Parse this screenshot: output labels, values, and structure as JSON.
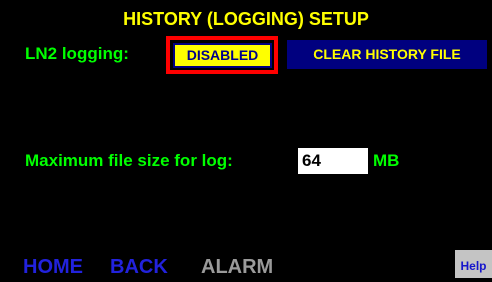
{
  "title": "HISTORY (LOGGING) SETUP",
  "logging": {
    "label": "LN2 logging:",
    "toggle_label": "DISABLED",
    "clear_button_label": "CLEAR HISTORY FILE"
  },
  "max_file_size": {
    "label": "Maximum file size for log:",
    "value": "64",
    "unit": "MB"
  },
  "nav": {
    "home": "HOME",
    "back": "BACK",
    "alarm": "ALARM",
    "help": "Help"
  },
  "colors": {
    "background": "#000000",
    "title": "#ffff00",
    "label": "#00ff00",
    "toggle_bg": "#ffff00",
    "toggle_highlight": "#ff0000",
    "clear_button_bg": "#00007f",
    "nav_active": "#2222dd",
    "nav_disabled": "#9a9a9a",
    "help_bg": "#c4c4c4"
  }
}
